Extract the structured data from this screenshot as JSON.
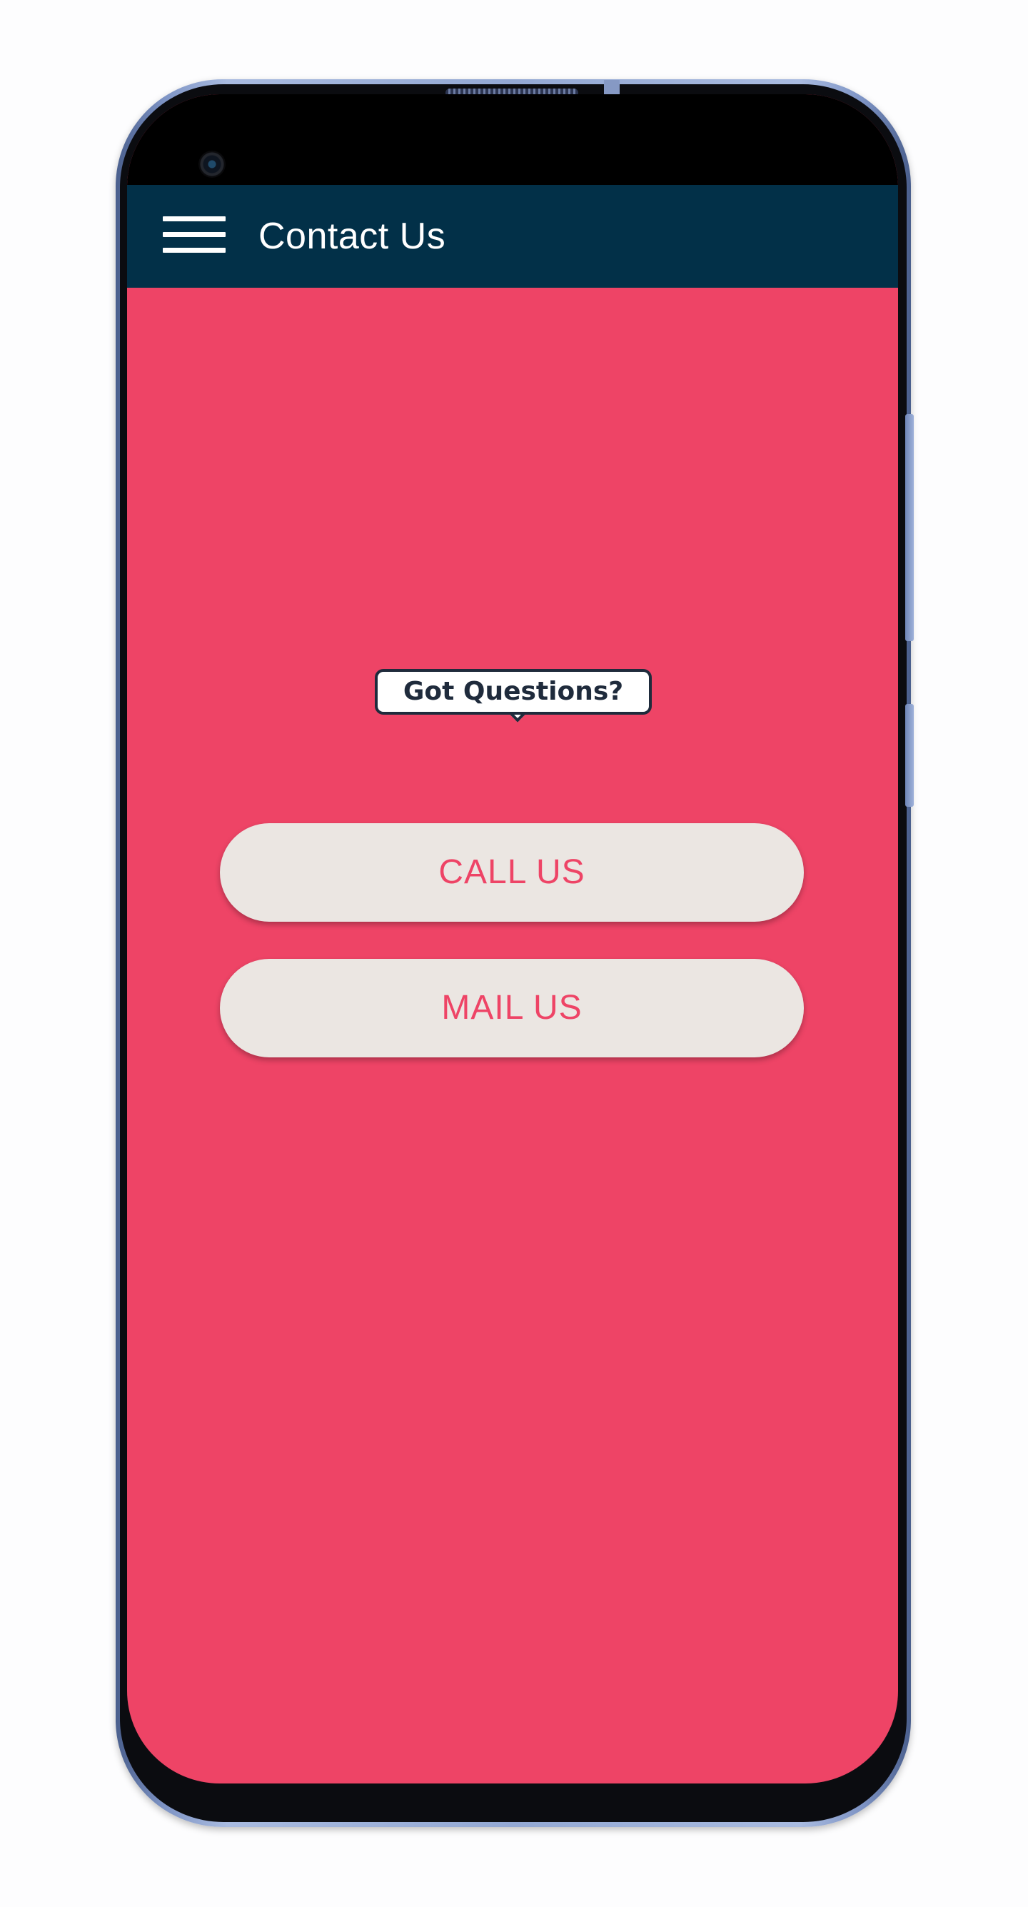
{
  "colors": {
    "screen_background": "#ee4466",
    "app_bar": "#023048",
    "button_background": "#ebe6e2",
    "button_text": "#ee4466",
    "bubble_text": "#1f2b3c"
  },
  "app_bar": {
    "menu_icon": "hamburger-menu-icon",
    "title": "Contact Us"
  },
  "main": {
    "bubble_text": "Got Questions?",
    "call_button_label": "CALL US",
    "mail_button_label": "MAIL US"
  }
}
